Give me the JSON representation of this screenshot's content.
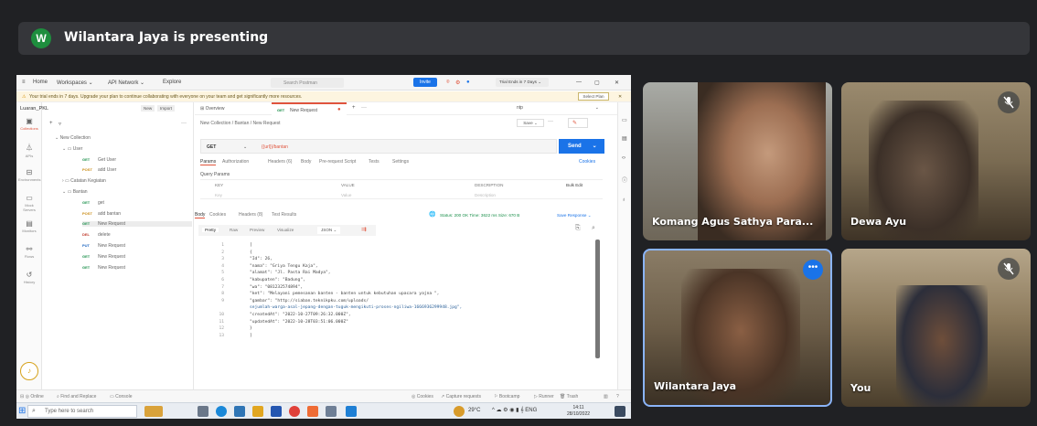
{
  "presenter": {
    "initial": "W",
    "text": "Wilantara Jaya is presenting"
  },
  "postman": {
    "topnav": {
      "home": "Home",
      "workspaces": "Workspaces ⌄",
      "api_network": "API Network ⌄",
      "explore": "Explore",
      "search_placeholder": "Search Postman",
      "invite": "Invite",
      "trial": "Trial Ends in 7 Days ⌄"
    },
    "banner": {
      "text": "Your trial ends in 7 days. Upgrade your plan to continue collaborating with everyone on your team and get significantly more resources.",
      "plan_button": "Select Plan"
    },
    "workspace": {
      "name": "Luaran_PKL",
      "new": "New",
      "import": "Import"
    },
    "rail": [
      "Collections",
      "APIs",
      "Environments",
      "Mock Servers",
      "Monitors",
      "Flows",
      "History"
    ],
    "tree": [
      {
        "type": "folder",
        "label": "New Collection"
      },
      {
        "type": "folder",
        "label": "User"
      },
      {
        "type": "request",
        "method": "GET",
        "label": "Get User"
      },
      {
        "type": "request",
        "method": "POST",
        "label": "add User"
      },
      {
        "type": "folder",
        "label": "Catatan Kegiatan"
      },
      {
        "type": "folder",
        "label": "Bantan"
      },
      {
        "type": "request",
        "method": "GET",
        "label": "get"
      },
      {
        "type": "request",
        "method": "POST",
        "label": "add bantan"
      },
      {
        "type": "request",
        "method": "GET",
        "label": "New Request"
      },
      {
        "type": "request",
        "method": "DEL",
        "label": "delete"
      },
      {
        "type": "request",
        "method": "PUT",
        "label": "New Request"
      },
      {
        "type": "request",
        "method": "GET",
        "label": "New Request"
      },
      {
        "type": "request",
        "method": "GET",
        "label": "New Request"
      }
    ],
    "tabs": {
      "overview": "Overview",
      "request": "New Request",
      "env": "ntp"
    },
    "breadcrumb": "New Collection / Bantan / New Request",
    "save": "Save",
    "request": {
      "method": "GET",
      "url": "{{url}}/bantan",
      "send": "Send"
    },
    "req_tabs": [
      "Params",
      "Authorization",
      "Headers (6)",
      "Body",
      "Pre-request Script",
      "Tests",
      "Settings"
    ],
    "cookies": "Cookies",
    "query_params": "Query Params",
    "params_cols": [
      "KEY",
      "VALUE",
      "DESCRIPTION"
    ],
    "bulk_edit": "Bulk Edit",
    "params_row": {
      "key": "Key",
      "value": "Value",
      "description": "Description"
    },
    "res_tabs": [
      "Body",
      "Cookies",
      "Headers (8)",
      "Test Results"
    ],
    "res_status": "Status: 200 OK   Time: 3622 ms   Size: 670 B",
    "save_response": "Save Response ⌄",
    "view_tabs": [
      "Pretty",
      "Raw",
      "Preview",
      "Visualize"
    ],
    "format": "JSON ⌄",
    "code": [
      {
        "n": "1",
        "t": "["
      },
      {
        "n": "2",
        "t": "  {"
      },
      {
        "n": "3",
        "t": "    \"Id\": 26,"
      },
      {
        "n": "4",
        "t": "    \"nama\": \"Griya Tengu Kaja\","
      },
      {
        "n": "5",
        "t": "    \"alamat\": \"Jl. Pasta Rai Madya\","
      },
      {
        "n": "6",
        "t": "    \"kabupaten\": \"Badung\","
      },
      {
        "n": "7",
        "t": "    \"wa\": \"081232574894\","
      },
      {
        "n": "8",
        "t": "    \"ket\": \"Melayani pemesanan banten - banten untuk kebutuhan upacara yajna \","
      },
      {
        "n": "9",
        "t": "    \"gambar\": \"http://siaban.teknikpku.com/uploads/"
      },
      {
        "n": "",
        "t": "      sejumlah-warga-asal-jepang-dengan-tuguk-mengikuti-proses-ngiliwa-1666936299948.jpg\","
      },
      {
        "n": "10",
        "t": "    \"createdAt\": \"2022-10-27T09:26:32.000Z\","
      },
      {
        "n": "11",
        "t": "    \"updatedAt\": \"2022-10-28T03:51:06.000Z\""
      },
      {
        "n": "12",
        "t": "  }"
      },
      {
        "n": "13",
        "t": "]"
      }
    ],
    "status_bar": {
      "online": "Online",
      "find": "Find and Replace",
      "console": "Console",
      "cookies": "Cookies",
      "capture": "Capture requests",
      "bootcamp": "Bootcamp",
      "runner": "Runner",
      "trash": "Trash"
    }
  },
  "taskbar": {
    "search": "Type here to search",
    "weather": "29°C",
    "time": "14:11",
    "date": "28/10/2022"
  },
  "participants": [
    {
      "name": "Komang Agus Sathya Para...",
      "muted": false
    },
    {
      "name": "Dewa Ayu",
      "muted": true
    },
    {
      "name": "Wilantara Jaya",
      "muted": false
    },
    {
      "name": "You",
      "muted": true
    }
  ]
}
